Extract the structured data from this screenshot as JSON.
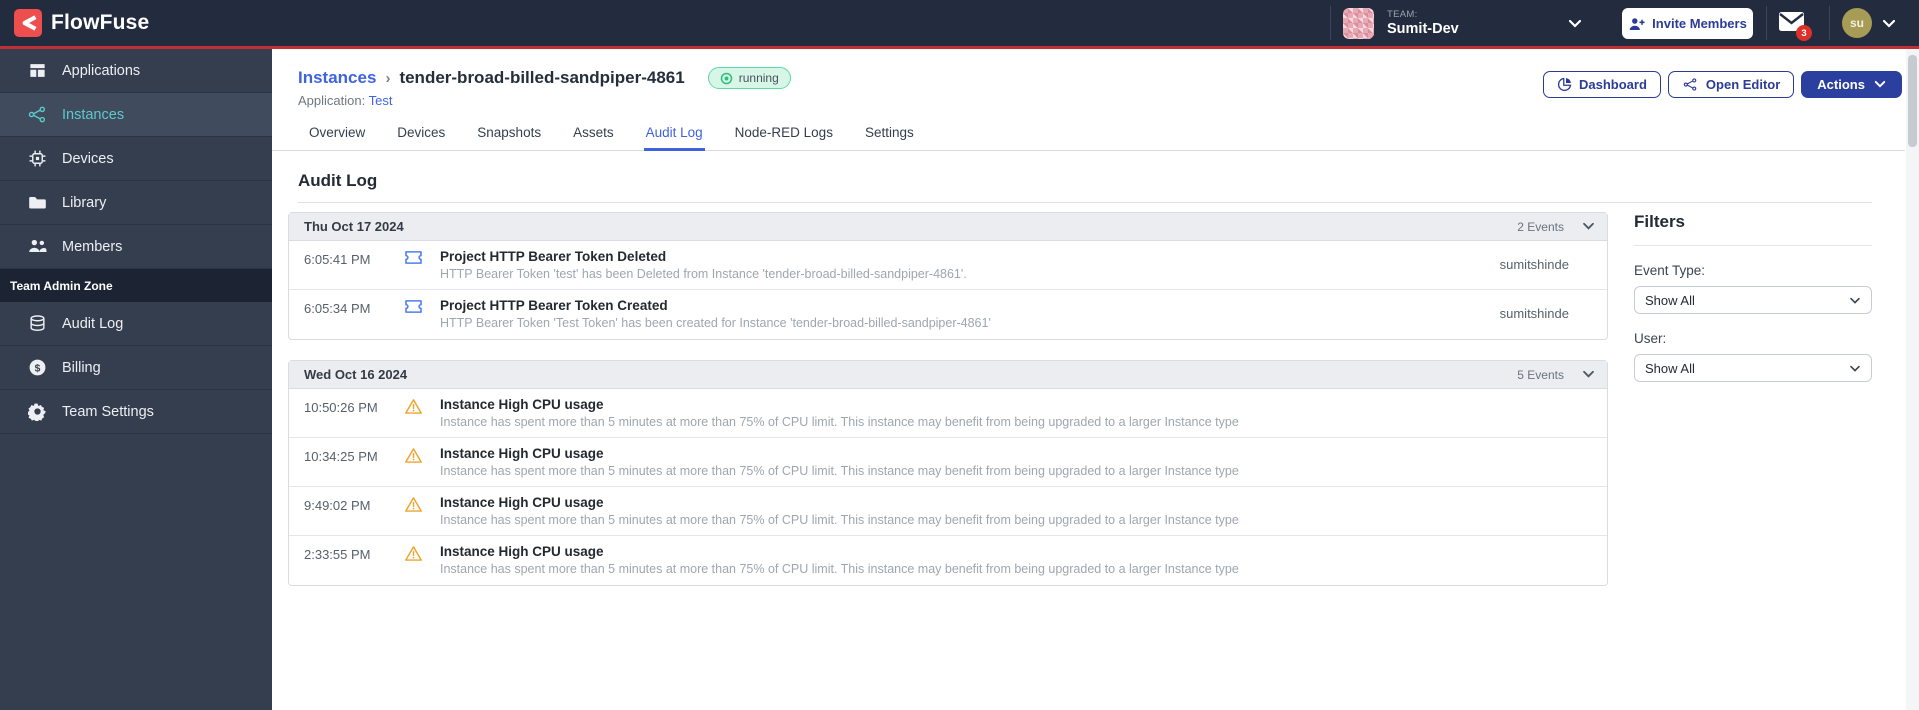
{
  "topbar": {
    "brand": "FlowFuse",
    "team_label": "TEAM:",
    "team_name": "Sumit-Dev",
    "invite_label": "Invite Members",
    "mail_badge": "3",
    "avatar_initials": "su"
  },
  "sidebar": {
    "items": [
      {
        "label": "Applications"
      },
      {
        "label": "Instances"
      },
      {
        "label": "Devices"
      },
      {
        "label": "Library"
      },
      {
        "label": "Members"
      }
    ],
    "admin_header": "Team Admin Zone",
    "admin_items": [
      {
        "label": "Audit Log"
      },
      {
        "label": "Billing"
      },
      {
        "label": "Team Settings"
      }
    ]
  },
  "page": {
    "breadcrumb_root": "Instances",
    "breadcrumb_sep": "›",
    "instance_name": "tender-broad-billed-sandpiper-4861",
    "status": "running",
    "application_label": "Application:",
    "application_name": "Test",
    "buttons": {
      "dashboard": "Dashboard",
      "open_editor": "Open Editor",
      "actions": "Actions"
    },
    "tabs": [
      {
        "label": "Overview"
      },
      {
        "label": "Devices"
      },
      {
        "label": "Snapshots"
      },
      {
        "label": "Assets"
      },
      {
        "label": "Audit Log"
      },
      {
        "label": "Node-RED Logs"
      },
      {
        "label": "Settings"
      }
    ],
    "section_title": "Audit Log"
  },
  "audit": {
    "groups": [
      {
        "date": "Thu Oct 17 2024",
        "count_label": "2 Events",
        "events": [
          {
            "time": "6:05:41 PM",
            "icon": "token-ticket",
            "title": "Project HTTP Bearer Token Deleted",
            "description": "HTTP Bearer Token 'test' has been Deleted from Instance 'tender-broad-billed-sandpiper-4861'.",
            "user": "sumitshinde"
          },
          {
            "time": "6:05:34 PM",
            "icon": "token-ticket",
            "title": "Project HTTP Bearer Token Created",
            "description": "HTTP Bearer Token 'Test Token' has been created for Instance 'tender-broad-billed-sandpiper-4861'",
            "user": "sumitshinde"
          }
        ]
      },
      {
        "date": "Wed Oct 16 2024",
        "count_label": "5 Events",
        "events": [
          {
            "time": "10:50:26 PM",
            "icon": "warning-triangle",
            "title": "Instance High CPU usage",
            "description": "Instance has spent more than 5 minutes at more than 75% of CPU limit. This instance may benefit from being upgraded to a larger Instance type",
            "user": ""
          },
          {
            "time": "10:34:25 PM",
            "icon": "warning-triangle",
            "title": "Instance High CPU usage",
            "description": "Instance has spent more than 5 minutes at more than 75% of CPU limit. This instance may benefit from being upgraded to a larger Instance type",
            "user": ""
          },
          {
            "time": "9:49:02 PM",
            "icon": "warning-triangle",
            "title": "Instance High CPU usage",
            "description": "Instance has spent more than 5 minutes at more than 75% of CPU limit. This instance may benefit from being upgraded to a larger Instance type",
            "user": ""
          },
          {
            "time": "2:33:55 PM",
            "icon": "warning-triangle",
            "title": "Instance High CPU usage",
            "description": "Instance has spent more than 5 minutes at more than 75% of CPU limit. This instance may benefit from being upgraded to a larger Instance type",
            "user": ""
          }
        ]
      }
    ]
  },
  "filters": {
    "title": "Filters",
    "event_type_label": "Event Type:",
    "event_type_value": "Show All",
    "user_label": "User:",
    "user_value": "Show All"
  },
  "colors": {
    "topbar": "#232C3E",
    "accent_red": "#BE3036",
    "logo_red": "#EE4E4E",
    "sidebar": "#343E4F",
    "sidebar_active_text": "#5CC9CB",
    "link_blue": "#3F63E0",
    "button_blue": "#2B3B97",
    "running_bg": "#D7F6E7",
    "running_border": "#5FD8A4",
    "warning_orange": "#F0A32E",
    "ticket_blue": "#4E7FEE",
    "badge_red": "#DC3128"
  }
}
